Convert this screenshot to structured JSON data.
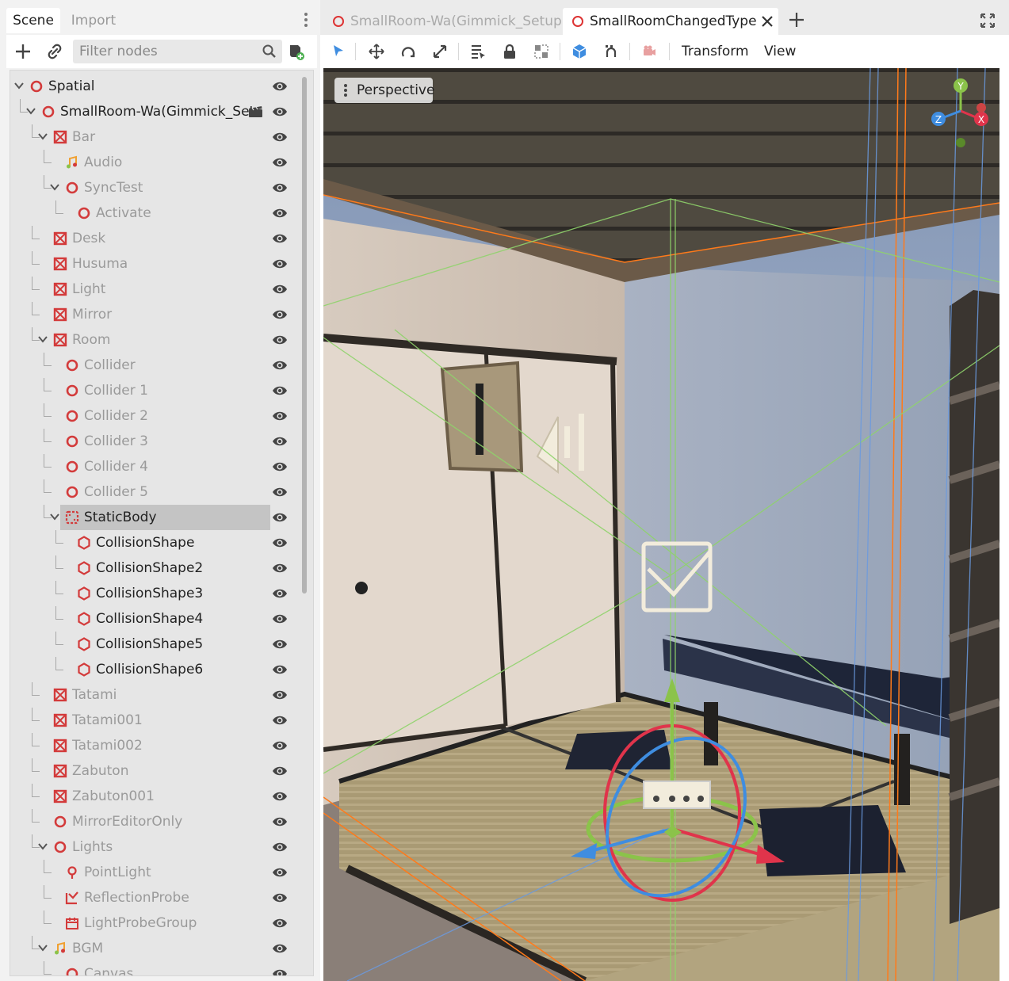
{
  "scene_dock": {
    "tabs": [
      "Scene",
      "Import"
    ],
    "filter_placeholder": "Filter nodes",
    "tree": [
      {
        "label": "Spatial",
        "icon": "spatial-icon",
        "expanded": true
      },
      {
        "label": "SmallRoom-Wa(Gimmick_Set",
        "icon": "spatial-icon",
        "expanded": true,
        "instanced_scene": true
      },
      {
        "label": "Bar",
        "icon": "mesh-icon",
        "expanded": true
      },
      {
        "label": "Audio",
        "icon": "audio-icon"
      },
      {
        "label": "SyncTest",
        "icon": "spatial-icon",
        "expanded": true
      },
      {
        "label": "Activate",
        "icon": "spatial-icon"
      },
      {
        "label": "Desk",
        "icon": "mesh-icon"
      },
      {
        "label": "Husuma",
        "icon": "mesh-icon"
      },
      {
        "label": "Light",
        "icon": "mesh-icon"
      },
      {
        "label": "Mirror",
        "icon": "mesh-icon"
      },
      {
        "label": "Room",
        "icon": "mesh-icon",
        "expanded": true
      },
      {
        "label": "Collider",
        "icon": "spatial-icon"
      },
      {
        "label": "Collider 1",
        "icon": "spatial-icon"
      },
      {
        "label": "Collider 2",
        "icon": "spatial-icon"
      },
      {
        "label": "Collider 3",
        "icon": "spatial-icon"
      },
      {
        "label": "Collider 4",
        "icon": "spatial-icon"
      },
      {
        "label": "Collider 5",
        "icon": "spatial-icon"
      },
      {
        "label": "StaticBody",
        "icon": "static-body-icon",
        "expanded": true,
        "selected": true
      },
      {
        "label": "CollisionShape",
        "icon": "collision-shape-icon"
      },
      {
        "label": "CollisionShape2",
        "icon": "collision-shape-icon"
      },
      {
        "label": "CollisionShape3",
        "icon": "collision-shape-icon"
      },
      {
        "label": "CollisionShape4",
        "icon": "collision-shape-icon"
      },
      {
        "label": "CollisionShape5",
        "icon": "collision-shape-icon"
      },
      {
        "label": "CollisionShape6",
        "icon": "collision-shape-icon"
      },
      {
        "label": "Tatami",
        "icon": "mesh-icon"
      },
      {
        "label": "Tatami001",
        "icon": "mesh-icon"
      },
      {
        "label": "Tatami002",
        "icon": "mesh-icon"
      },
      {
        "label": "Zabuton",
        "icon": "mesh-icon"
      },
      {
        "label": "Zabuton001",
        "icon": "mesh-icon"
      },
      {
        "label": "MirrorEditorOnly",
        "icon": "spatial-icon"
      },
      {
        "label": "Lights",
        "icon": "spatial-icon",
        "expanded": true
      },
      {
        "label": "PointLight",
        "icon": "point-light-icon"
      },
      {
        "label": "ReflectionProbe",
        "icon": "reflection-probe-icon"
      },
      {
        "label": "LightProbeGroup",
        "icon": "light-probe-group-icon"
      },
      {
        "label": "BGM",
        "icon": "audio-icon",
        "expanded": true
      },
      {
        "label": "Canvas",
        "icon": "spatial-icon"
      }
    ]
  },
  "editor": {
    "tabs": [
      {
        "label": "SmallRoom-Wa(Gimmick_Setup)",
        "active": false
      },
      {
        "label": "SmallRoomChangedType",
        "active": true
      }
    ],
    "menus": {
      "transform": "Transform",
      "view": "View"
    },
    "viewport": {
      "perspective_label": "Perspective"
    },
    "gizmo_axes": {
      "y": "Y",
      "z": "Z",
      "x": "X"
    },
    "colors": {
      "node_red": "#d33b3b",
      "axis_x": "#e0344b",
      "axis_y": "#8bc34a",
      "axis_z": "#3f8de0",
      "selection": "#c4c4c4"
    }
  }
}
